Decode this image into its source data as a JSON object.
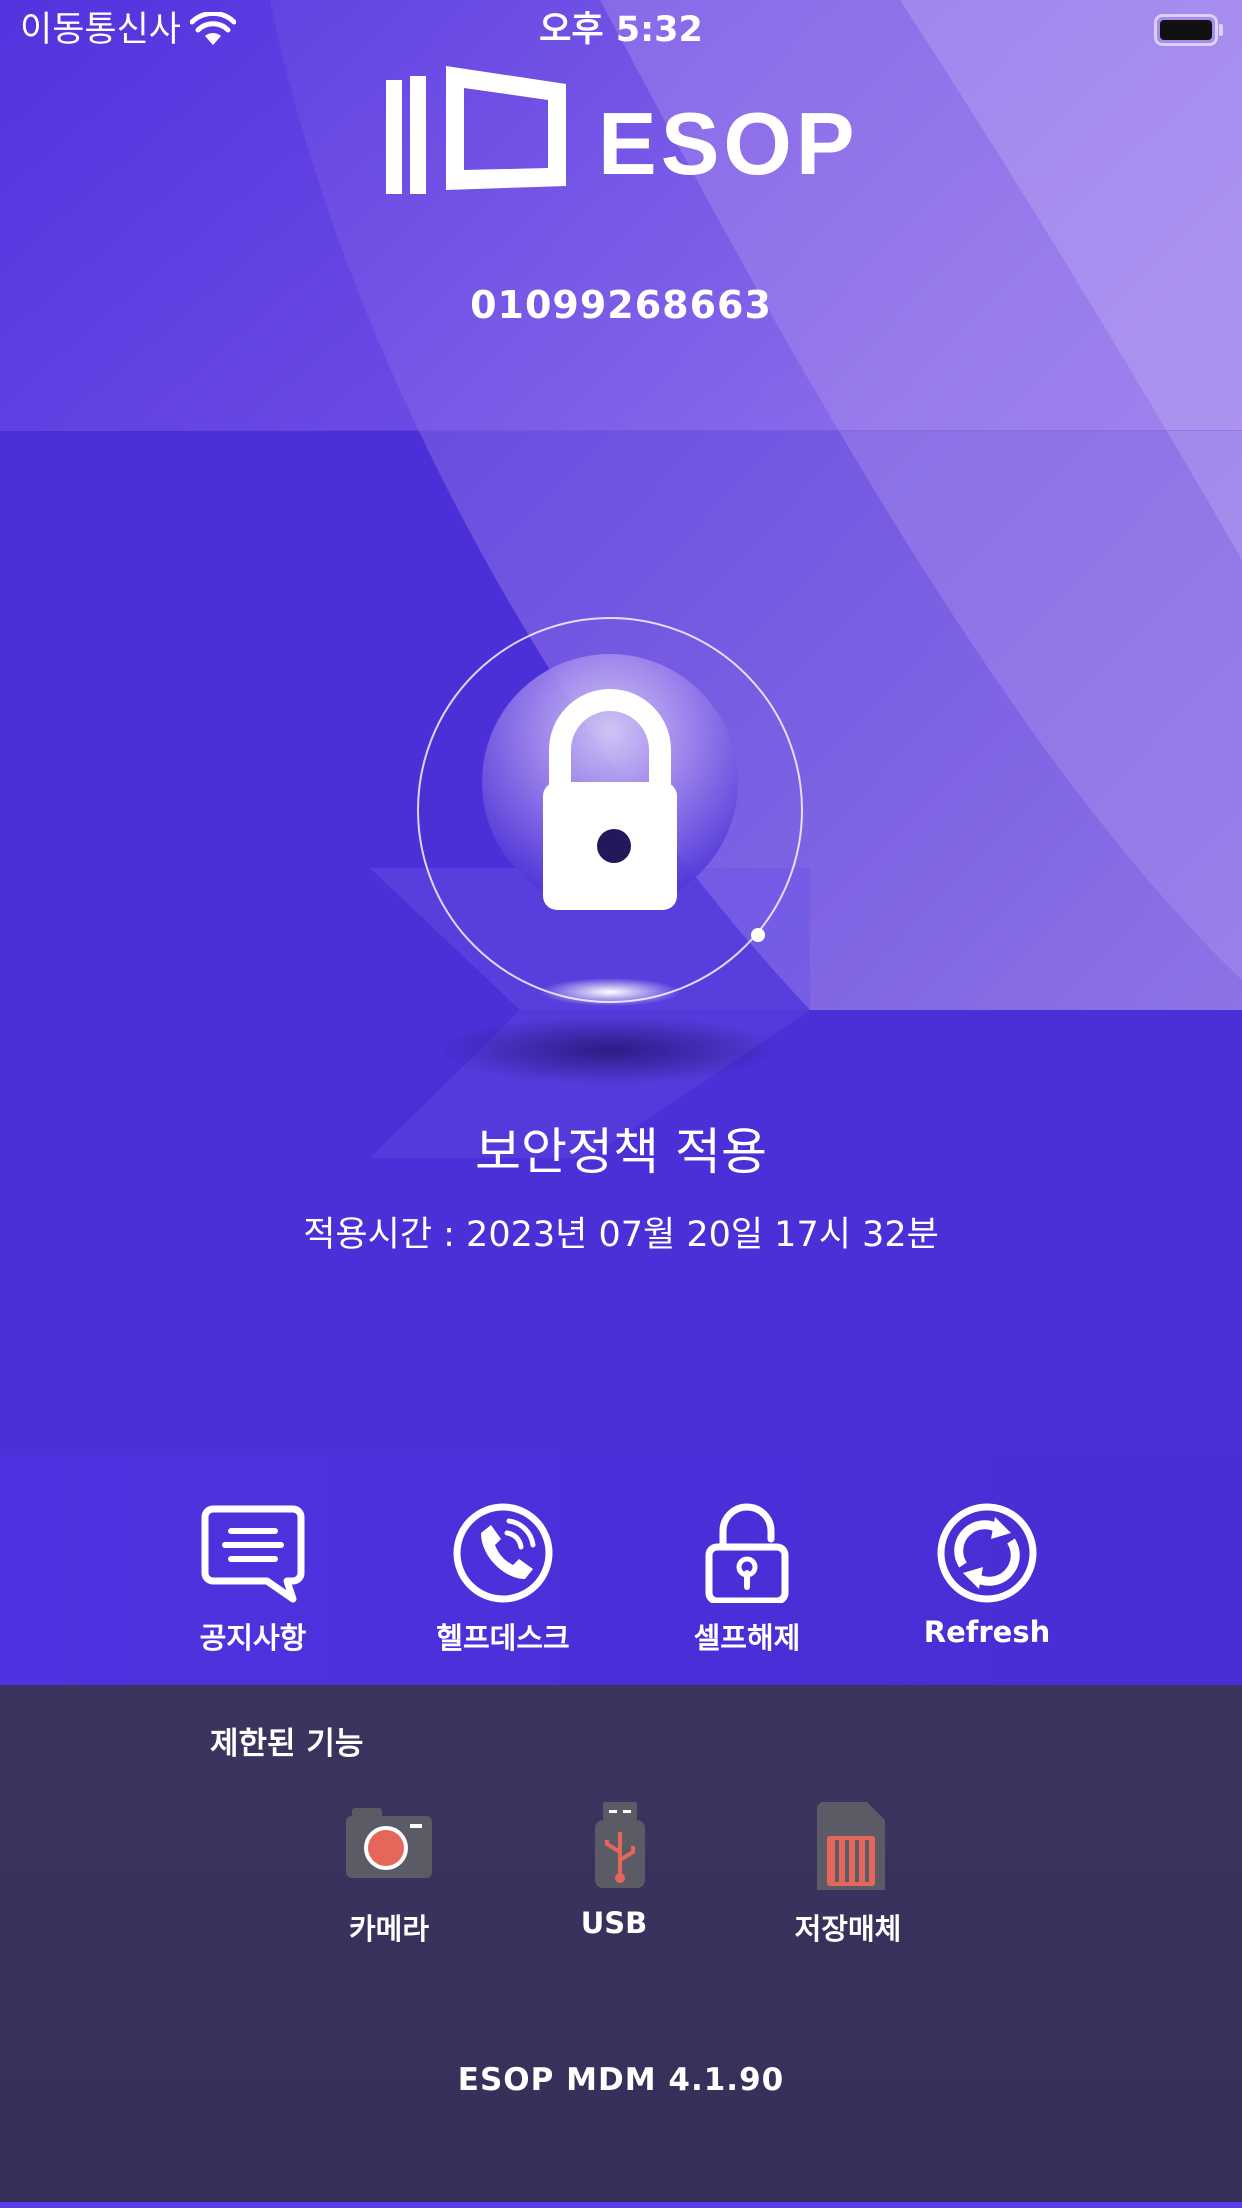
{
  "status_bar": {
    "carrier": "이동통신사",
    "time": "오후 5:32",
    "wifi_icon": "wifi-icon",
    "battery_icon": "battery-icon"
  },
  "header": {
    "brand": "ESOP",
    "phone_number": "01099268663"
  },
  "policy": {
    "icon": "lock-icon",
    "title": "보안정책 적용",
    "applied_time": "적용시간 : 2023년 07월 20일 17시 32분"
  },
  "actions": [
    {
      "label": "공지사항",
      "icon": "speech-bubble-icon"
    },
    {
      "label": "헬프데스크",
      "icon": "phone-call-icon"
    },
    {
      "label": "셀프해제",
      "icon": "unlock-icon"
    },
    {
      "label": "Refresh",
      "icon": "refresh-icon"
    }
  ],
  "restricted": {
    "title": "제한된 기능",
    "items": [
      {
        "label": "카메라",
        "icon": "camera-icon"
      },
      {
        "label": "USB",
        "icon": "usb-icon"
      },
      {
        "label": "저장매체",
        "icon": "sd-card-icon"
      }
    ]
  },
  "footer": {
    "version": "ESOP MDM 4.1.90"
  },
  "colors": {
    "primary": "#4a30d6",
    "panel": "#37325c",
    "restricted_red": "#e5675c"
  }
}
